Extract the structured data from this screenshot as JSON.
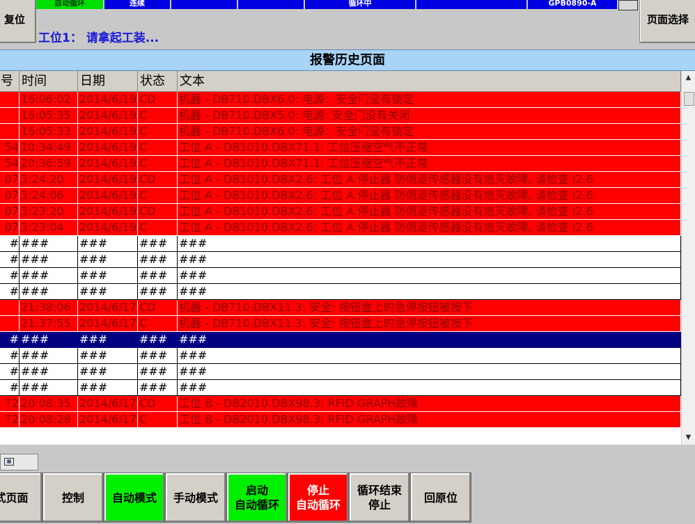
{
  "status_strip": {
    "cells": [
      {
        "text": "自动循环",
        "style": "green"
      },
      {
        "text": "连续",
        "style": "blue"
      },
      {
        "text": "",
        "style": "blue"
      },
      {
        "text": "",
        "style": "blue"
      },
      {
        "text": "循环中",
        "style": "blue"
      },
      {
        "text": "",
        "style": "blue"
      },
      {
        "text": "GPB0890-A",
        "style": "blue"
      },
      {
        "text": "",
        "style": "gray"
      }
    ]
  },
  "header": {
    "reset_label": "复位",
    "page_select_label": "页面选择",
    "station_message": "工位1： 请拿起工装...",
    "page_title": "报警历史页面"
  },
  "table": {
    "columns": [
      "号",
      "时间",
      "日期",
      "状态",
      "文本"
    ],
    "rows": [
      {
        "no": "",
        "time": "16:06:02",
        "date": "2014/6/19",
        "state": "CD",
        "text": "机器 - DB710.DBX6.0: 电源：安全门没有锁定",
        "style": "red"
      },
      {
        "no": "",
        "time": "16:05:35",
        "date": "2014/6/19",
        "state": "C",
        "text": "机器 - DB710.DBX5.0: 电源: 安全门没有关闭",
        "style": "red"
      },
      {
        "no": "",
        "time": "16:05:33",
        "date": "2014/6/19",
        "state": "C",
        "text": "机器 - DB710.DBX6.0: 电源：安全门没有锁定",
        "style": "red"
      },
      {
        "no": "54",
        "time": "10:34:49",
        "date": "2014/6/19",
        "state": "C",
        "text": "工位 A - DB1010.DBX71.1: 工位压缩空气不正常",
        "style": "red"
      },
      {
        "no": "54",
        "time": "20:36:59",
        "date": "2014/6/19",
        "state": "C",
        "text": "工位 A - DB1010.DBX71.1: 工位压缩空气不正常",
        "style": "red"
      },
      {
        "no": "07",
        "time": "3:24:20",
        "date": "2014/6/19",
        "state": "CD",
        "text": "工位 A - DB1010.DBX2.6: 工位 A 停止器 防倒退传感器没有熄灭故障, 请检查 I2.6",
        "style": "red"
      },
      {
        "no": "07",
        "time": "3:24:06",
        "date": "2014/6/19",
        "state": "C",
        "text": "工位 A - DB1010.DBX2.6: 工位 A 停止器 防倒退传感器没有熄灭故障, 请检查 I2.6",
        "style": "red"
      },
      {
        "no": "07",
        "time": "3:23:20",
        "date": "2014/6/19",
        "state": "CD",
        "text": "工位 A - DB1010.DBX2.6: 工位 A 停止器 防倒退传感器没有熄灭故障, 请检查 I2.6",
        "style": "red"
      },
      {
        "no": "07",
        "time": "3:23:04",
        "date": "2014/6/19",
        "state": "C",
        "text": "工位 A - DB1010.DBX2.6: 工位 A 停止器 防倒退传感器没有熄灭故障, 请检查 I2.6",
        "style": "red"
      },
      {
        "no": "#",
        "time": "###",
        "date": "###",
        "state": "###",
        "text": "###",
        "style": "white"
      },
      {
        "no": "#",
        "time": "###",
        "date": "###",
        "state": "###",
        "text": "###",
        "style": "white"
      },
      {
        "no": "#",
        "time": "###",
        "date": "###",
        "state": "###",
        "text": "###",
        "style": "white"
      },
      {
        "no": "#",
        "time": "###",
        "date": "###",
        "state": "###",
        "text": "###",
        "style": "white"
      },
      {
        "no": "",
        "time": "21:38:06",
        "date": "2014/6/17",
        "state": "CD",
        "text": "机器 - DB710.DBX11.3: 安全: 按钮盒上的急停按钮被按下",
        "style": "red"
      },
      {
        "no": "",
        "time": "21:37:55",
        "date": "2014/6/17",
        "state": "C",
        "text": "机器 - DB710.DBX11.3: 安全: 按钮盒上的急停按钮被按下",
        "style": "red"
      },
      {
        "no": "#",
        "time": "###",
        "date": "###",
        "state": "###",
        "text": "###",
        "style": "sel"
      },
      {
        "no": "#",
        "time": "###",
        "date": "###",
        "state": "###",
        "text": "###",
        "style": "white"
      },
      {
        "no": "#",
        "time": "###",
        "date": "###",
        "state": "###",
        "text": "###",
        "style": "white"
      },
      {
        "no": "#",
        "time": "###",
        "date": "###",
        "state": "###",
        "text": "###",
        "style": "white"
      },
      {
        "no": "72",
        "time": "20:08:35",
        "date": "2014/6/17",
        "state": "CD",
        "text": "工位 B - DB2010.DBX98.3: RFID GRAPH故障",
        "style": "red"
      },
      {
        "no": "72",
        "time": "20:08:28",
        "date": "2014/6/17",
        "state": "C",
        "text": "工位 B - DB2010.DBX98.3: RFID GRAPH故障",
        "style": "red"
      }
    ]
  },
  "bottom_buttons": [
    {
      "label": "式页面",
      "style": "gray"
    },
    {
      "label": "控制",
      "style": "gray"
    },
    {
      "label": "自动模式",
      "style": "green"
    },
    {
      "label": "手动模式",
      "style": "gray"
    },
    {
      "label": "启动\n自动循环",
      "style": "green2"
    },
    {
      "label": "停止\n自动循环",
      "style": "red"
    },
    {
      "label": "循环结束\n停止",
      "style": "gray"
    },
    {
      "label": "回原位",
      "style": "gray"
    }
  ],
  "colors": {
    "alarm_red": "#ff0000",
    "alarm_text": "#8b0000",
    "selected_row": "#000080",
    "title_bar": "#a8d4f8",
    "station_text": "#1a1ad8",
    "mode_green": "#00f000"
  },
  "icons": {
    "mini_widget": "calendar-icon",
    "scroll_up": "scroll-up-arrow-icon",
    "scroll_down": "scroll-down-arrow-icon"
  }
}
